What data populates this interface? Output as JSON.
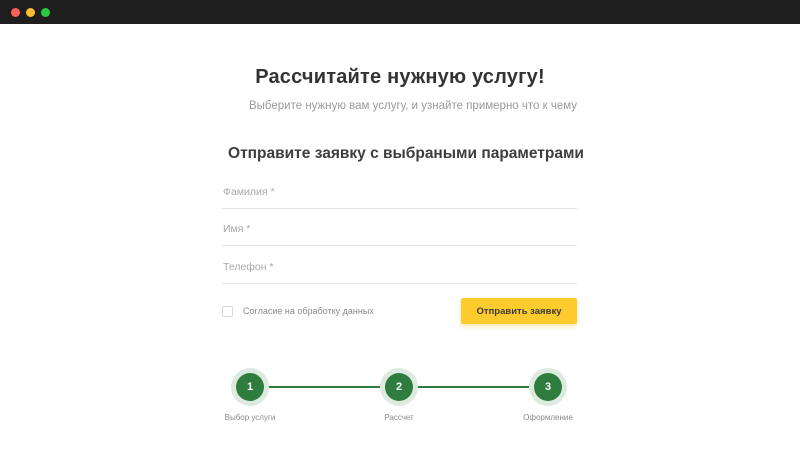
{
  "window": {
    "controls": [
      "close",
      "minimize",
      "maximize"
    ],
    "colors": {
      "bar": "#1e1e1e",
      "close": "#ff5f56",
      "minimize": "#ffbd2e",
      "maximize": "#27c93f"
    }
  },
  "header": {
    "title": "Рассчитайте нужную услугу!",
    "subtitle": "Выберите нужную вам услугу, и узнайте примерно что к чему"
  },
  "form": {
    "heading": "Отправите заявку с выбраными параметрами",
    "fields": [
      {
        "placeholder": "Фамилия *",
        "value": ""
      },
      {
        "placeholder": "Имя *",
        "value": ""
      },
      {
        "placeholder": "Телефон *",
        "value": ""
      }
    ],
    "consent": {
      "label": "Согласие на обработку данных",
      "checked": false
    },
    "submit_label": "Отправить заявку",
    "submit_color": "#fecb2f"
  },
  "stepper": {
    "accent_color": "#2f7d3e",
    "steps": [
      {
        "number": "1",
        "label": "Выбор услуги"
      },
      {
        "number": "2",
        "label": "Рассчет"
      },
      {
        "number": "3",
        "label": "Оформление"
      }
    ]
  }
}
